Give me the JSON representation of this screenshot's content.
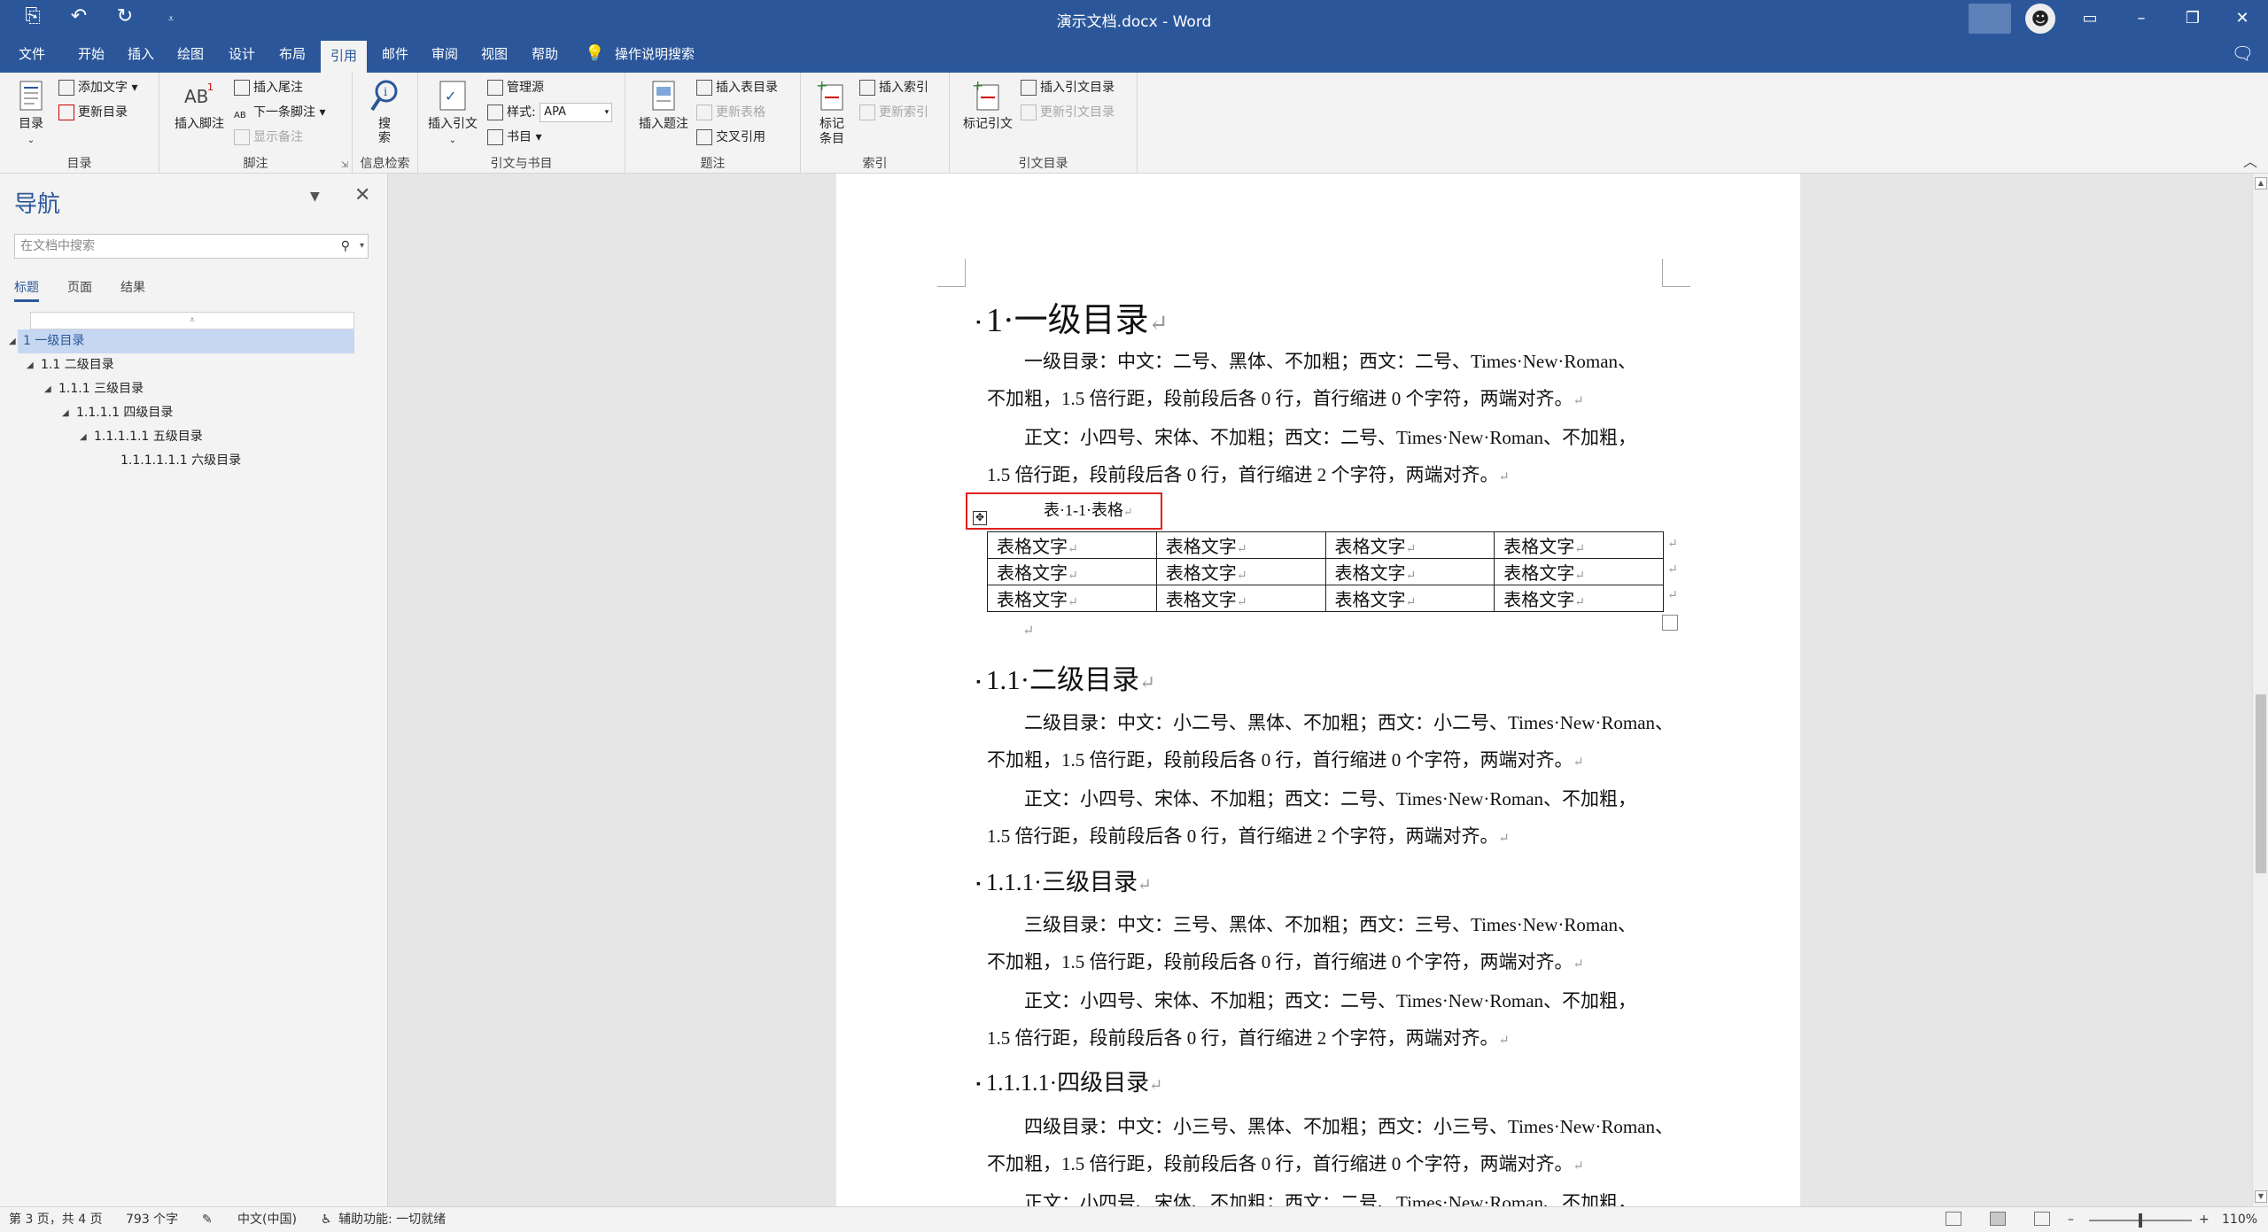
{
  "titlebar": {
    "title": "演示文档.docx - Word",
    "save_icon": "save-icon",
    "undo_icon": "undo-icon",
    "redo_icon": "redo-icon",
    "customize_icon": "customize-qat-icon"
  },
  "tabs": [
    "文件",
    "开始",
    "插入",
    "绘图",
    "设计",
    "布局",
    "引用",
    "邮件",
    "审阅",
    "视图",
    "帮助"
  ],
  "active_tab": "引用",
  "tell_me": "操作说明搜索",
  "ribbon": {
    "toc": {
      "big": "目录",
      "add_text": "添加文字",
      "update": "更新目录",
      "label": "目录"
    },
    "footnotes": {
      "big": "插入脚注",
      "insert_endnote": "插入尾注",
      "next_footnote": "下一条脚注",
      "show_notes": "显示备注",
      "label": "脚注"
    },
    "research": {
      "big": "搜索",
      "label": "信息检索"
    },
    "citations": {
      "big": "插入引文",
      "manage": "管理源",
      "style_label": "样式:",
      "style_value": "APA",
      "bibliography": "书目",
      "label": "引文与书目"
    },
    "captions": {
      "big": "插入题注",
      "insert_tof": "插入表目录",
      "update_table": "更新表格",
      "cross_ref": "交叉引用",
      "label": "题注"
    },
    "index": {
      "big": "标记条目",
      "insert_index": "插入索引",
      "update_index": "更新索引",
      "label": "索引"
    },
    "toa": {
      "big": "标记引文",
      "insert_toa": "插入引文目录",
      "update_toa": "更新引文目录",
      "label": "引文目录"
    }
  },
  "nav": {
    "title": "导航",
    "search_placeholder": "在文档中搜索",
    "tabs": [
      "标题",
      "页面",
      "结果"
    ],
    "tree": [
      {
        "label": "1 一级目录",
        "level": 0,
        "selected": true,
        "expand": true
      },
      {
        "label": "1.1 二级目录",
        "level": 1,
        "selected": false,
        "expand": true
      },
      {
        "label": "1.1.1 三级目录",
        "level": 2,
        "selected": false,
        "expand": true
      },
      {
        "label": "1.1.1.1 四级目录",
        "level": 3,
        "selected": false,
        "expand": true
      },
      {
        "label": "1.1.1.1.1 五级目录",
        "level": 4,
        "selected": false,
        "expand": true
      },
      {
        "label": "1.1.1.1.1.1 六级目录",
        "level": 5,
        "selected": false,
        "expand": false
      }
    ]
  },
  "doc": {
    "h1": "1·一级目录",
    "p1a": "一级目录：中文：二号、黑体、不加粗；西文：二号、Times·New·Roman、",
    "p1b": "不加粗，1.5 倍行距，段前段后各 0 行，首行缩进 0 个字符，两端对齐。",
    "p2a": "正文：小四号、宋体、不加粗；西文：二号、Times·New·Roman、不加粗，",
    "p2b": "1.5 倍行距，段前段后各 0 行，首行缩进 2 个字符，两端对齐。",
    "caption": "表·1-1·表格",
    "table": [
      [
        "表格文字",
        "表格文字",
        "表格文字",
        "表格文字"
      ],
      [
        "表格文字",
        "表格文字",
        "表格文字",
        "表格文字"
      ],
      [
        "表格文字",
        "表格文字",
        "表格文字",
        "表格文字"
      ]
    ],
    "h2": "1.1·二级目录",
    "p3a": "二级目录：中文：小二号、黑体、不加粗；西文：小二号、Times·New·Roman、",
    "p3b": "不加粗，1.5 倍行距，段前段后各 0 行，首行缩进 0 个字符，两端对齐。",
    "p4a": "正文：小四号、宋体、不加粗；西文：二号、Times·New·Roman、不加粗，",
    "p4b": "1.5 倍行距，段前段后各 0 行，首行缩进 2 个字符，两端对齐。",
    "h3": "1.1.1·三级目录",
    "p5a": "三级目录：中文：三号、黑体、不加粗；西文：三号、Times·New·Roman、",
    "p5b": "不加粗，1.5 倍行距，段前段后各 0 行，首行缩进 0 个字符，两端对齐。",
    "p6a": "正文：小四号、宋体、不加粗；西文：二号、Times·New·Roman、不加粗，",
    "p6b": "1.5 倍行距，段前段后各 0 行，首行缩进 2 个字符，两端对齐。",
    "h4": "1.1.1.1·四级目录",
    "p7a": "四级目录：中文：小三号、黑体、不加粗；西文：小三号、Times·New·Roman、",
    "p7b": "不加粗，1.5 倍行距，段前段后各 0 行，首行缩进 0 个字符，两端对齐。",
    "p8a": "正文：小四号、宋体、不加粗；西文：二号、Times·New·Roman、不加粗，"
  },
  "status": {
    "page": "第 3 页，共 4 页",
    "words": "793 个字",
    "language": "中文(中国)",
    "accessibility": "辅助功能: 一切就绪",
    "zoom": "110%"
  },
  "colors": {
    "accent": "#2b579a",
    "highlight": "#e02020",
    "nav_selected": "#c5d7f1"
  }
}
